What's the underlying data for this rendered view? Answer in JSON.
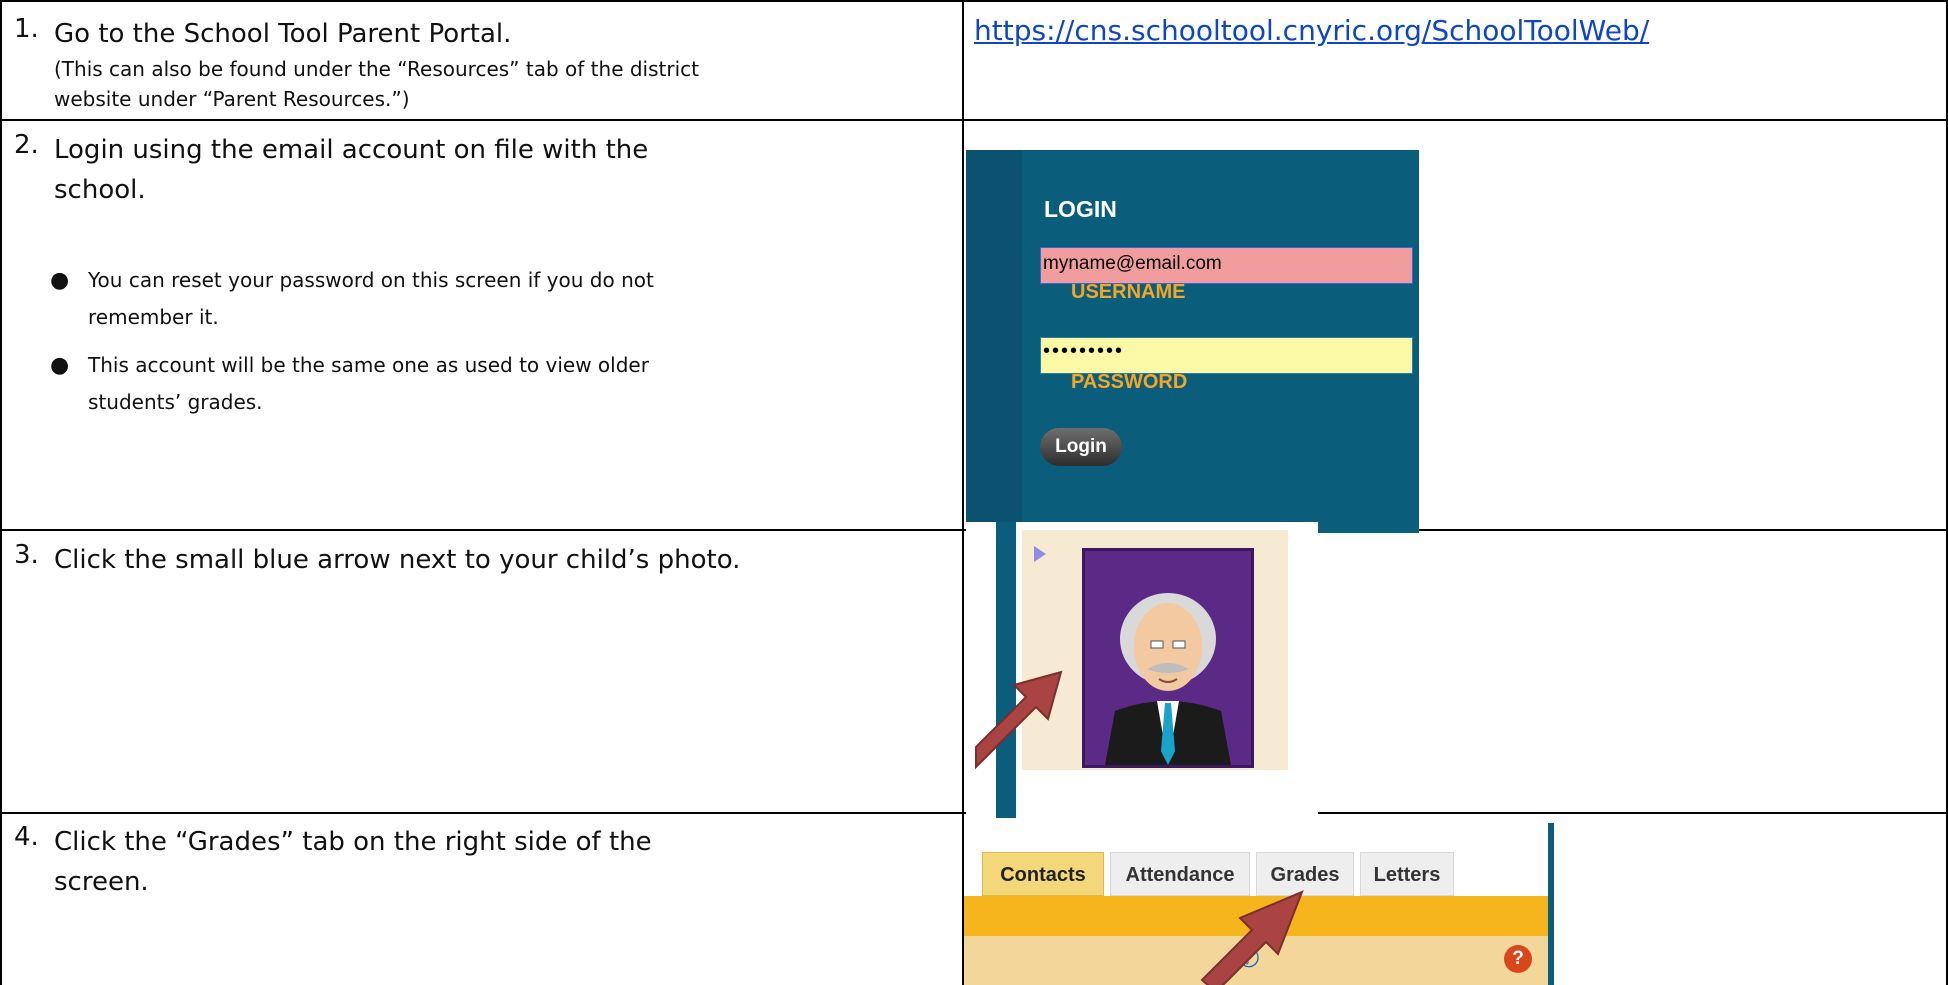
{
  "steps": [
    {
      "num": "1.",
      "text": "Go to the School Tool Parent Portal.",
      "note": "(This can also be found under the “Resources” tab of the district website under “Parent Resources.”)",
      "link": "https://cns.schooltool.cnyric.org/SchoolToolWeb/"
    },
    {
      "num": "2.",
      "text": "Login using the email account on file with the school.",
      "bullets": [
        "You can reset your password on this screen if you do not remember it.",
        "This account will be the same one as used to view older students’ grades."
      ]
    },
    {
      "num": "3.",
      "text": "Click the small blue arrow next to your child’s photo."
    },
    {
      "num": "4.",
      "text": "Click the “Grades” tab on the right side of the screen."
    }
  ],
  "login": {
    "title": "LOGIN",
    "username_value": "myname@email.com",
    "username_label": "USERNAME",
    "password_value": "•••••••••",
    "password_label": "PASSWORD",
    "button": "Login",
    "colors": {
      "panel": "#0b5d7c",
      "username_bg": "#f29d9d",
      "password_bg": "#fbf9a6",
      "label": "#f5a623"
    }
  },
  "student_card": {
    "arrow_icon": "play-triangle-icon",
    "pointer_icon": "red-arrow-icon"
  },
  "tabs": {
    "items": [
      "Contacts",
      "Attendance",
      "Grades",
      "Letters"
    ],
    "active": "Contacts",
    "icons": [
      "phone-icon",
      "help-icon"
    ],
    "colors": {
      "bar": "#f6b51d",
      "active_tab": "#f4d77a"
    }
  }
}
